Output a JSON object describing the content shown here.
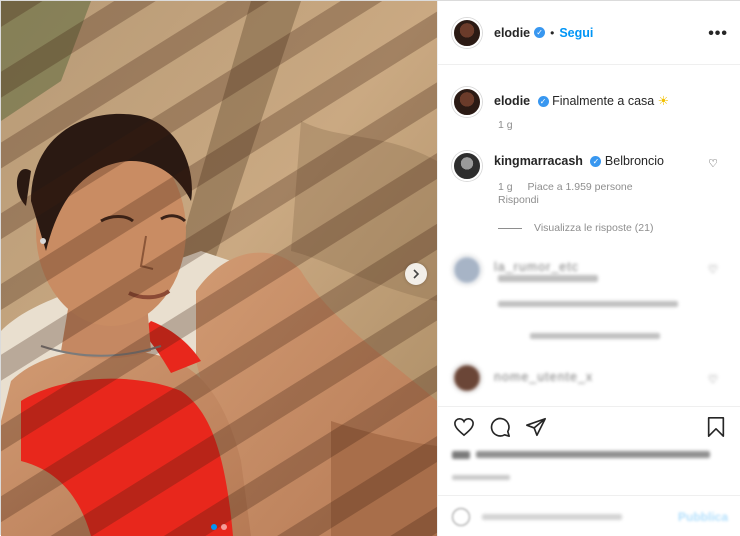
{
  "post": {
    "author": "elodie",
    "follow_label": "Segui",
    "separator": "•",
    "more_icon": "more-horizontal-icon"
  },
  "caption": {
    "username": "elodie",
    "text": "Finalmente a casa",
    "emoji": "☀",
    "time": "1 g"
  },
  "top_comment": {
    "username": "kingmarracash",
    "text": "Belbroncio",
    "time": "1 g",
    "likes": "Piace a 1.959 persone",
    "reply_label": "Rispondi",
    "view_replies": "Visualizza le risposte (21)"
  },
  "blurred": {
    "comment1_user": "la_rumor_etc",
    "comment2_user": "nome_utente_x"
  },
  "icons": {
    "verified": "✓",
    "heart": "heart-icon",
    "comment": "comment-icon",
    "share": "share-icon",
    "save": "bookmark-icon"
  },
  "colors": {
    "accent": "#0095f6",
    "verified": "#3897f0",
    "swimsuit": "#e8271c"
  }
}
